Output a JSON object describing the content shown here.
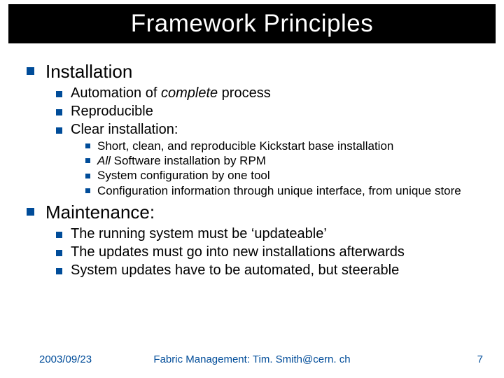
{
  "title": "Framework Principles",
  "sections": [
    {
      "heading": "Installation",
      "items": [
        {
          "pre": "Automation of ",
          "em": "complete",
          "post": " process"
        },
        {
          "pre": "Reproducible",
          "em": "",
          "post": ""
        },
        {
          "pre": "Clear installation:",
          "em": "",
          "post": ""
        }
      ],
      "subitems": [
        {
          "pre": "Short, clean, and reproducible Kickstart base installation",
          "em": "",
          "post": ""
        },
        {
          "pre": "",
          "em": "All",
          "post": " Software installation by RPM"
        },
        {
          "pre": "System configuration by one tool",
          "em": "",
          "post": ""
        },
        {
          "pre": "Configuration information through unique interface, from unique store",
          "em": "",
          "post": ""
        }
      ]
    },
    {
      "heading": "Maintenance:",
      "items": [
        {
          "pre": "The running system must be ‘updateable’",
          "em": "",
          "post": ""
        },
        {
          "pre": "The updates must go into new installations afterwards",
          "em": "",
          "post": ""
        },
        {
          "pre": "System updates have to be automated, but steerable",
          "em": "",
          "post": ""
        }
      ],
      "subitems": []
    }
  ],
  "footer": {
    "date": "2003/09/23",
    "middle": "Fabric Management: Tim. Smith@cern. ch",
    "page": "7"
  },
  "colors": {
    "accent": "#004c99",
    "titleBg": "#000000",
    "titleFg": "#ffffff"
  }
}
